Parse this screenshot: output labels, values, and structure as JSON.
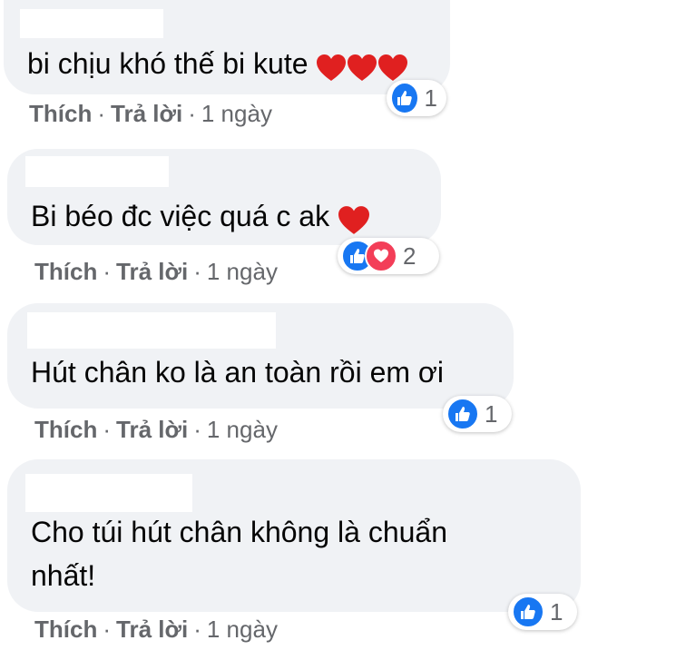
{
  "comments": [
    {
      "text": "bi chịu khó thế bi kute",
      "like_label": "Thích",
      "reply_label": "Trả lời",
      "time": "1 ngày",
      "reaction_count": "1",
      "reactions": [
        "like-icon"
      ],
      "emoji": [
        "red-heart-icon",
        "red-heart-icon",
        "red-heart-icon"
      ]
    },
    {
      "text": "Bi béo đc việc quá c ak",
      "like_label": "Thích",
      "reply_label": "Trả lời",
      "time": "1 ngày",
      "reaction_count": "2",
      "reactions": [
        "like-icon",
        "love-icon"
      ],
      "emoji": [
        "red-heart-icon"
      ]
    },
    {
      "text": "Hút chân ko là an toàn rồi em ơi",
      "like_label": "Thích",
      "reply_label": "Trả lời",
      "time": "1 ngày",
      "reaction_count": "1",
      "reactions": [
        "like-icon"
      ]
    },
    {
      "text_line1": "Cho túi hút chân không là chuẩn",
      "text_line2": "nhất!",
      "like_label": "Thích",
      "reply_label": "Trả lời",
      "time": "1 ngày",
      "reaction_count": "1",
      "reactions": [
        "like-icon"
      ]
    }
  ],
  "colors": {
    "bubble": "#f0f2f5",
    "like_blue": "#1877f2",
    "love_red": "#f33e58",
    "meta_gray": "#65676b"
  }
}
